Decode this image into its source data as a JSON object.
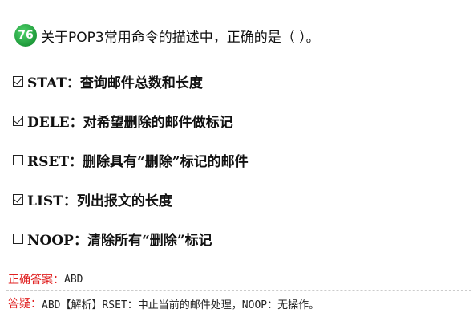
{
  "question": {
    "number": "76",
    "text": "关于POP3常用命令的描述中，正确的是（ ）。"
  },
  "options": [
    {
      "checked": true,
      "text": "STAT：查询邮件总数和长度"
    },
    {
      "checked": true,
      "text": "DELE：对希望删除的邮件做标记"
    },
    {
      "checked": false,
      "text": "RSET：删除具有“删除”标记的邮件"
    },
    {
      "checked": true,
      "text": "LIST：列出报文的长度"
    },
    {
      "checked": false,
      "text": "NOOP：清除所有“删除”标记"
    }
  ],
  "answer": {
    "label": "正确答案：",
    "value": "ABD"
  },
  "explanation": {
    "label": "答疑：",
    "text": "ABD【解析】RSET：中止当前的邮件处理，NOOP：无操作。"
  },
  "colors": {
    "badge": "#1e9a3a",
    "label_red": "#e02020"
  }
}
